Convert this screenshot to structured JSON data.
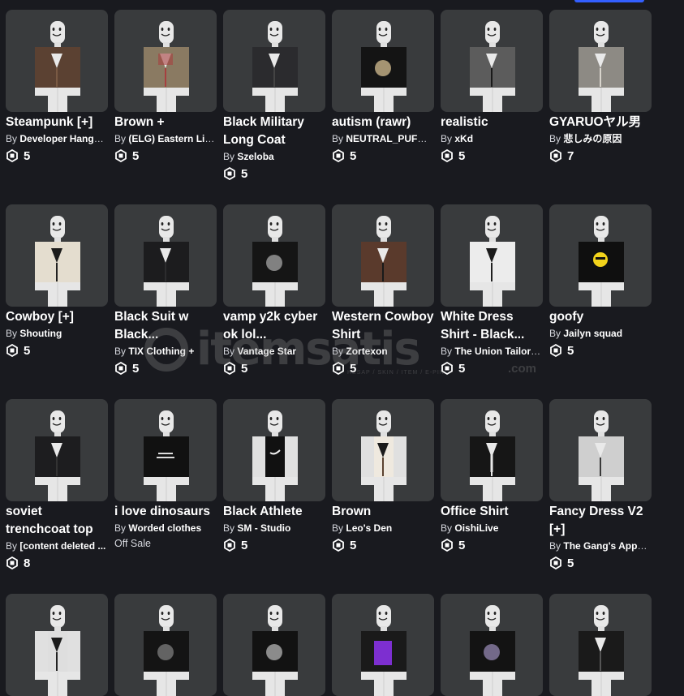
{
  "theme": {
    "background": "#191a1f",
    "card_thumb_bg": "#393b3d",
    "accent": "#335fff",
    "text": "#ffffff",
    "muted": "#d5d7dd"
  },
  "labels": {
    "by": "By"
  },
  "watermark": {
    "brand": "itemsatis",
    "tld": ".com",
    "tagline": "HESAP / SKIN / ITEM / E-PIN"
  },
  "items": [
    {
      "name": "Steampunk [+]",
      "creator": "Developer Hango...",
      "price": "5",
      "outfit": "brown-coat",
      "shirt": "#5b4132",
      "accent": "#7a5a44"
    },
    {
      "name": "Brown +",
      "creator": "(ELG) Eastern Lib...",
      "price": "5",
      "outfit": "plaid-vest",
      "shirt": "#8a7a62",
      "accent": "#a63f3f"
    },
    {
      "name": "Black Military Long Coat",
      "creator": "Szeloba",
      "price": "5",
      "outfit": "black-coat",
      "shirt": "#2b2b2e",
      "accent": "#444"
    },
    {
      "name": "autism (rawr)",
      "creator": "NEUTRAL_PUFFE...",
      "price": "5",
      "outfit": "graphic-tee",
      "shirt": "#141414",
      "accent": "#c9b48a"
    },
    {
      "name": "realistic",
      "creator": "xKd",
      "price": "5",
      "outfit": "grey-jacket",
      "shirt": "#5c5c5c",
      "accent": "#1a1a1a"
    },
    {
      "name": "GYARUOヤル男",
      "creator": "悲しみの原因",
      "price": "7",
      "outfit": "grey-blazer",
      "shirt": "#8d8a84",
      "accent": "#d8d4cc"
    },
    {
      "name": "Cowboy [+]",
      "creator": "Shouting",
      "price": "5",
      "outfit": "cream-vest",
      "shirt": "#e4ddcf",
      "accent": "#222"
    },
    {
      "name": "Black Suit w Black...",
      "creator": "TIX Clothing +",
      "price": "5",
      "outfit": "black-suit",
      "shirt": "#1c1c1e",
      "accent": "#2c2c2e"
    },
    {
      "name": "vamp y2k cyber ok lol...",
      "creator": "Vantage Star",
      "price": "5",
      "outfit": "print-tee",
      "shirt": "#151515",
      "accent": "#9c9c9c"
    },
    {
      "name": "Western Cowboy Shirt",
      "creator": "Zortexon",
      "price": "5",
      "outfit": "brown-vest",
      "shirt": "#5a3a2c",
      "accent": "#1a1a1a"
    },
    {
      "name": "White Dress Shirt - Black...",
      "creator": "The Union Tailori...",
      "price": "5",
      "outfit": "white-vest",
      "shirt": "#ececec",
      "accent": "#202020"
    },
    {
      "name": "goofy",
      "creator": "Jailyn squad",
      "price": "5",
      "outfit": "emoji-tee",
      "shirt": "#0f0f0f",
      "accent": "#f2d31b"
    },
    {
      "name": "soviet trenchcoat top",
      "creator": "[content deleted ...",
      "price": "8",
      "outfit": "black-coat",
      "shirt": "#1d1d1f",
      "accent": "#333"
    },
    {
      "name": "i love dinosaurs",
      "creator": "Worded clothes",
      "price": "",
      "offsale": "Off Sale",
      "outfit": "text-tee",
      "shirt": "#111",
      "accent": "#ddd"
    },
    {
      "name": "Black Athlete",
      "creator": "SM - Studio",
      "price": "5",
      "outfit": "athlete",
      "shirt": "#111",
      "accent": "#f0f0f0"
    },
    {
      "name": "Brown",
      "creator": "Leo's Den",
      "price": "5",
      "outfit": "brown-vest-white",
      "shirt": "#efe9df",
      "accent": "#5b4230"
    },
    {
      "name": "Office Shirt",
      "creator": "OishiLive",
      "price": "5",
      "outfit": "black-suit-tie",
      "shirt": "#161616",
      "accent": "#e8e8e8"
    },
    {
      "name": "Fancy Dress V2 [+]",
      "creator": "The Gang's Appar...",
      "price": "5",
      "outfit": "grey-blazer",
      "shirt": "#cfcfcf",
      "accent": "#3a3a3a"
    },
    {
      "name": "",
      "creator": "",
      "price": "",
      "outfit": "white-suit",
      "shirt": "#dedede",
      "accent": "#222"
    },
    {
      "name": "",
      "creator": "",
      "price": "",
      "outfit": "print-tee",
      "shirt": "#141414",
      "accent": "#777"
    },
    {
      "name": "",
      "creator": "",
      "price": "",
      "outfit": "print-tee",
      "shirt": "#121212",
      "accent": "#aaa"
    },
    {
      "name": "",
      "creator": "",
      "price": "",
      "outfit": "purple-tee",
      "shirt": "#1a1a1a",
      "accent": "#7d2fd0"
    },
    {
      "name": "",
      "creator": "",
      "price": "",
      "outfit": "print-tee",
      "shirt": "#131313",
      "accent": "#8c7fa8"
    },
    {
      "name": "",
      "creator": "",
      "price": "",
      "outfit": "black-coat",
      "shirt": "#1a1a1a",
      "accent": "#555"
    }
  ]
}
